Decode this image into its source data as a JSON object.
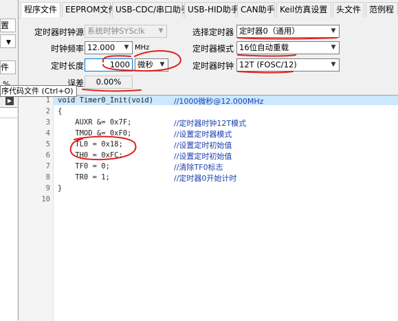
{
  "left_panel": {
    "button_1": "置",
    "button_2": "件",
    "badge": "%"
  },
  "tooltip": "序代码文件 (Ctrl+O)",
  "tabs": [
    {
      "label": "程序文件"
    },
    {
      "label": "EEPROM文件"
    },
    {
      "label": "USB-CDC/串口助手"
    },
    {
      "label": "USB-HID助手"
    },
    {
      "label": "CAN助手"
    },
    {
      "label": "Keil仿真设置"
    },
    {
      "label": "头文件"
    },
    {
      "label": "范例程"
    }
  ],
  "settings": {
    "clock_source_label": "定时器时钟源",
    "clock_source_value": "系统时钟SYSclk",
    "select_timer_label": "选择定时器",
    "select_timer_value": "定时器0（通用）",
    "clock_freq_label": "时钟频率",
    "clock_freq_value": "12.000",
    "clock_freq_unit": "MHz",
    "timer_mode_label": "定时器模式",
    "timer_mode_value": "16位自动重载",
    "timer_length_label": "定时长度",
    "timer_length_value": "1000",
    "timer_unit_value": "微秒",
    "timer_clock_label": "定时器时钟",
    "timer_clock_value": "12T (FOSC/12)",
    "error_label": "误差",
    "error_value": "0.00%"
  },
  "code": [
    {
      "n": "1",
      "code": "void Timer0_Init(void)",
      "comment": "//1000微秒@12.000MHz"
    },
    {
      "n": "2",
      "code": "{",
      "comment": ""
    },
    {
      "n": "3",
      "code": "    AUXR &= 0x7F;",
      "comment": "//定时器时钟12T模式"
    },
    {
      "n": "4",
      "code": "    TMOD &= 0xF0;",
      "comment": "//设置定时器模式"
    },
    {
      "n": "5",
      "code": "    TL0 = 0x18;",
      "comment": "//设置定时初始值"
    },
    {
      "n": "6",
      "code": "    TH0 = 0xFC;",
      "comment": "//设置定时初始值"
    },
    {
      "n": "7",
      "code": "    TF0 = 0;",
      "comment": "//清除TF0标志"
    },
    {
      "n": "8",
      "code": "    TR0 = 1;",
      "comment": "//定时器0开始计时"
    },
    {
      "n": "9",
      "code": "}",
      "comment": ""
    },
    {
      "n": "10",
      "code": "",
      "comment": ""
    }
  ],
  "colors": {
    "annotation": "#e02020",
    "comment": "#1a3fb0",
    "highlight": "#cce8ff"
  }
}
